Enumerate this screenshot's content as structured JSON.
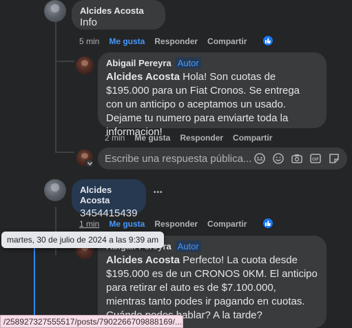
{
  "comments": [
    {
      "author": "Alcides Acosta",
      "text": "Info",
      "time": "5 min",
      "like_label": "Me gusta",
      "reply_label": "Responder",
      "share_label": "Compartir"
    },
    {
      "author": "Abigail Pereyra",
      "badge": "Autor",
      "mention": "Alcides Acosta",
      "text": " Hola! Son cuotas de $195.000 para un Fiat Cronos. Se entrega con un anticipo o aceptamos un usado. Dejame tu numero para enviarte toda la informacion!",
      "time": "2 min",
      "like_label": "Me gusta",
      "reply_label": "Responder",
      "share_label": "Compartir"
    },
    {
      "author": "Alcides Acosta",
      "text": "3454415439",
      "time": "1 min",
      "like_label": "Me gusta",
      "reply_label": "Responder",
      "share_label": "Compartir"
    },
    {
      "author": "Abigail Pereyra",
      "badge": "Autor",
      "mention": "Alcides Acosta",
      "text": " Perfecto! La cuota desde $195.000 es de un CRONOS 0KM. El anticipo para retirar el auto es de $7.100.000, mientras tanto podes ir pagando en cuotas. Cuándo podes hablar? A la tarde?"
    }
  ],
  "reply_box": {
    "placeholder": "Escribe una respuesta pública..."
  },
  "tooltip": "martes, 30 de julio de 2024 a las 9:39 am",
  "status_url": "/258927327555517/posts/7902266709888169/...",
  "more_icon": "•••",
  "colors": {
    "background": "#242526",
    "bubble": "#3a3b3c",
    "accent": "#4599ff",
    "like_blue": "#1877f2"
  },
  "icons": [
    "thumbs-up-icon",
    "sticker-icon",
    "emoji-icon",
    "camera-icon",
    "gif-icon",
    "sticker-face-icon"
  ]
}
